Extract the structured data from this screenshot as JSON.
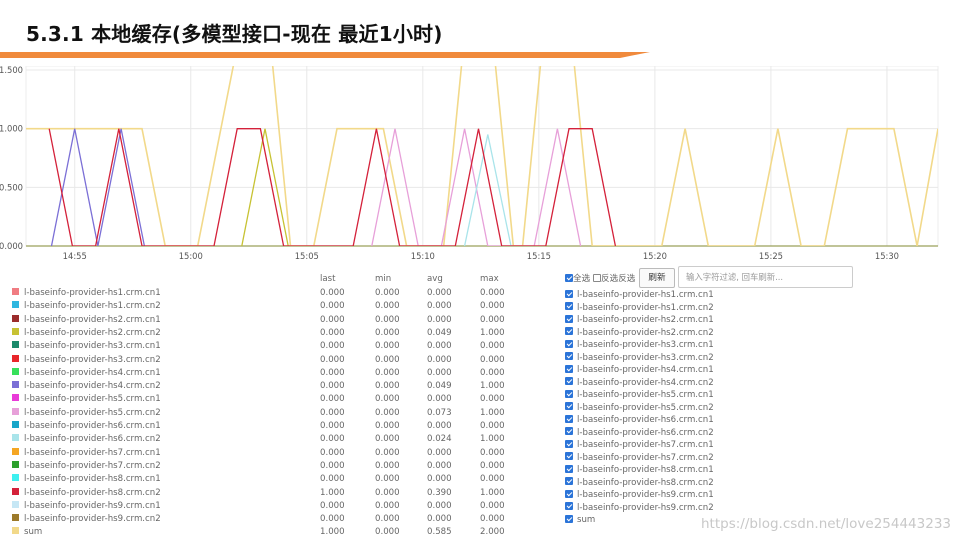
{
  "title": "5.3.1 本地缓存(多模型接口-现在 最近1小时)",
  "accent_color": "#f08a3c",
  "chart_data": {
    "type": "line",
    "x_ticks": [
      "14:55",
      "15:00",
      "15:05",
      "15:10",
      "15:15",
      "15:20",
      "15:25",
      "15:30"
    ],
    "y_ticks": [
      "0.000",
      "0.500",
      "1.000",
      "1.500"
    ],
    "ylim": [
      0,
      1.5
    ],
    "xlim_minutes": [
      -2.1,
      37.2
    ],
    "grid": true,
    "series": [
      {
        "name": "l-baseinfo-provider-hs2.crm.cn2",
        "color": "#c7c233",
        "points": [
          [
            7.2,
            0
          ],
          [
            8.2,
            1
          ],
          [
            9.2,
            0
          ]
        ]
      },
      {
        "name": "l-baseinfo-provider-hs4.crm.cn2",
        "color": "#7b6fd6",
        "points": [
          [
            -1.0,
            0
          ],
          [
            0.0,
            1
          ],
          [
            1.0,
            0
          ],
          [
            2.0,
            1
          ],
          [
            3.0,
            0
          ]
        ]
      },
      {
        "name": "l-baseinfo-provider-hs5.crm.cn2",
        "color": "#e7a0d9",
        "points": [
          [
            12.8,
            0
          ],
          [
            13.8,
            1
          ],
          [
            14.8,
            0
          ],
          [
            15.8,
            0
          ],
          [
            16.8,
            1
          ],
          [
            17.8,
            0
          ],
          [
            19.8,
            0
          ],
          [
            20.8,
            1
          ],
          [
            21.8,
            0
          ]
        ]
      },
      {
        "name": "l-baseinfo-provider-hs6.crm.cn2",
        "color": "#a9e4ea",
        "points": [
          [
            16.8,
            0
          ],
          [
            17.8,
            0.95
          ],
          [
            18.8,
            0
          ]
        ]
      },
      {
        "name": "l-baseinfo-provider-hs8.crm.cn2",
        "color": "#d4213a",
        "points": [
          [
            -1.1,
            1
          ],
          [
            -0.1,
            0
          ],
          [
            0.9,
            0
          ],
          [
            1.9,
            1
          ],
          [
            2.9,
            0
          ],
          [
            6.0,
            0
          ],
          [
            7.0,
            1
          ],
          [
            8.0,
            1
          ],
          [
            9.0,
            0
          ],
          [
            12.0,
            0
          ],
          [
            13.0,
            1
          ],
          [
            14.0,
            0
          ],
          [
            16.4,
            0
          ],
          [
            17.4,
            1
          ],
          [
            18.4,
            0
          ],
          [
            20.3,
            0
          ],
          [
            21.3,
            1
          ],
          [
            22.3,
            1
          ],
          [
            23.3,
            0
          ]
        ]
      },
      {
        "name": "sum",
        "color": "#f2d98a",
        "points": [
          [
            -2.1,
            1
          ],
          [
            1.9,
            1
          ],
          [
            2.9,
            1
          ],
          [
            3.9,
            0
          ],
          [
            5.3,
            0
          ],
          [
            6.3,
            1
          ],
          [
            7.3,
            2
          ],
          [
            8.3,
            2
          ],
          [
            9.3,
            0
          ],
          [
            10.3,
            0
          ],
          [
            11.3,
            1
          ],
          [
            12.3,
            1
          ],
          [
            13.3,
            1
          ],
          [
            14.3,
            0
          ],
          [
            15.9,
            0
          ],
          [
            16.9,
            2
          ],
          [
            17.9,
            2
          ],
          [
            18.9,
            0
          ],
          [
            19.3,
            0
          ],
          [
            20.3,
            2
          ],
          [
            21.3,
            2
          ],
          [
            22.3,
            0
          ],
          [
            23.3,
            0
          ],
          [
            24.3,
            0
          ],
          [
            25.3,
            0
          ],
          [
            26.3,
            1
          ],
          [
            27.3,
            0
          ],
          [
            29.3,
            0
          ],
          [
            30.3,
            1
          ],
          [
            31.3,
            0
          ],
          [
            32.3,
            0
          ],
          [
            33.3,
            1
          ],
          [
            34.3,
            1
          ],
          [
            35.3,
            1
          ],
          [
            36.3,
            0
          ],
          [
            37.2,
            1
          ]
        ]
      }
    ]
  },
  "legend_table": {
    "headers": {
      "last": "last",
      "min": "min",
      "avg": "avg",
      "max": "max"
    },
    "rows": [
      {
        "name": "l-baseinfo-provider-hs1.crm.cn1",
        "color": "#f07c82",
        "last": "0.000",
        "min": "0.000",
        "avg": "0.000",
        "max": "0.000"
      },
      {
        "name": "l-baseinfo-provider-hs1.crm.cn2",
        "color": "#2fb7e0",
        "last": "0.000",
        "min": "0.000",
        "avg": "0.000",
        "max": "0.000"
      },
      {
        "name": "l-baseinfo-provider-hs2.crm.cn1",
        "color": "#9b2c2c",
        "last": "0.000",
        "min": "0.000",
        "avg": "0.000",
        "max": "0.000"
      },
      {
        "name": "l-baseinfo-provider-hs2.crm.cn2",
        "color": "#c7c233",
        "last": "0.000",
        "min": "0.000",
        "avg": "0.049",
        "max": "1.000"
      },
      {
        "name": "l-baseinfo-provider-hs3.crm.cn1",
        "color": "#1b8a6b",
        "last": "0.000",
        "min": "0.000",
        "avg": "0.000",
        "max": "0.000"
      },
      {
        "name": "l-baseinfo-provider-hs3.crm.cn2",
        "color": "#e8262a",
        "last": "0.000",
        "min": "0.000",
        "avg": "0.000",
        "max": "0.000"
      },
      {
        "name": "l-baseinfo-provider-hs4.crm.cn1",
        "color": "#36e05a",
        "last": "0.000",
        "min": "0.000",
        "avg": "0.000",
        "max": "0.000"
      },
      {
        "name": "l-baseinfo-provider-hs4.crm.cn2",
        "color": "#7b6fd6",
        "last": "0.000",
        "min": "0.000",
        "avg": "0.049",
        "max": "1.000"
      },
      {
        "name": "l-baseinfo-provider-hs5.crm.cn1",
        "color": "#e93ad8",
        "last": "0.000",
        "min": "0.000",
        "avg": "0.000",
        "max": "0.000"
      },
      {
        "name": "l-baseinfo-provider-hs5.crm.cn2",
        "color": "#e7a0d9",
        "last": "0.000",
        "min": "0.000",
        "avg": "0.073",
        "max": "1.000"
      },
      {
        "name": "l-baseinfo-provider-hs6.crm.cn1",
        "color": "#18a6c9",
        "last": "0.000",
        "min": "0.000",
        "avg": "0.000",
        "max": "0.000"
      },
      {
        "name": "l-baseinfo-provider-hs6.crm.cn2",
        "color": "#a9e4ea",
        "last": "0.000",
        "min": "0.000",
        "avg": "0.024",
        "max": "1.000"
      },
      {
        "name": "l-baseinfo-provider-hs7.crm.cn1",
        "color": "#f5a623",
        "last": "0.000",
        "min": "0.000",
        "avg": "0.000",
        "max": "0.000"
      },
      {
        "name": "l-baseinfo-provider-hs7.crm.cn2",
        "color": "#2ca02c",
        "last": "0.000",
        "min": "0.000",
        "avg": "0.000",
        "max": "0.000"
      },
      {
        "name": "l-baseinfo-provider-hs8.crm.cn1",
        "color": "#3ef0f0",
        "last": "0.000",
        "min": "0.000",
        "avg": "0.000",
        "max": "0.000"
      },
      {
        "name": "l-baseinfo-provider-hs8.crm.cn2",
        "color": "#d4213a",
        "last": "1.000",
        "min": "0.000",
        "avg": "0.390",
        "max": "1.000"
      },
      {
        "name": "l-baseinfo-provider-hs9.crm.cn1",
        "color": "#c6e7f5",
        "last": "0.000",
        "min": "0.000",
        "avg": "0.000",
        "max": "0.000"
      },
      {
        "name": "l-baseinfo-provider-hs9.crm.cn2",
        "color": "#9c7a2a",
        "last": "0.000",
        "min": "0.000",
        "avg": "0.000",
        "max": "0.000"
      },
      {
        "name": "sum",
        "color": "#f2d98a",
        "last": "1.000",
        "min": "0.000",
        "avg": "0.585",
        "max": "2.000"
      }
    ]
  },
  "controls": {
    "select_all": "全选",
    "invert": "反选反选",
    "refresh": "刷新",
    "filter_placeholder": "输入字符过滤, 回车刷新..."
  },
  "series_list": [
    "l-baseinfo-provider-hs1.crm.cn1",
    "l-baseinfo-provider-hs1.crm.cn2",
    "l-baseinfo-provider-hs2.crm.cn1",
    "l-baseinfo-provider-hs2.crm.cn2",
    "l-baseinfo-provider-hs3.crm.cn1",
    "l-baseinfo-provider-hs3.crm.cn2",
    "l-baseinfo-provider-hs4.crm.cn1",
    "l-baseinfo-provider-hs4.crm.cn2",
    "l-baseinfo-provider-hs5.crm.cn1",
    "l-baseinfo-provider-hs5.crm.cn2",
    "l-baseinfo-provider-hs6.crm.cn1",
    "l-baseinfo-provider-hs6.crm.cn2",
    "l-baseinfo-provider-hs7.crm.cn1",
    "l-baseinfo-provider-hs7.crm.cn2",
    "l-baseinfo-provider-hs8.crm.cn1",
    "l-baseinfo-provider-hs8.crm.cn2",
    "l-baseinfo-provider-hs9.crm.cn1",
    "l-baseinfo-provider-hs9.crm.cn2",
    "sum"
  ],
  "watermark": "https://blog.csdn.net/love254443233"
}
